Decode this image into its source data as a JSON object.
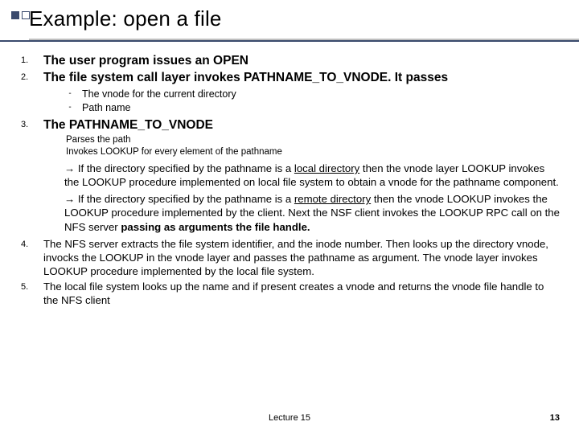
{
  "title": "Example: open a file",
  "items": {
    "n1": "1.",
    "t1": "The user program issues an OPEN",
    "n2": "2.",
    "t2": "The file system call layer invokes PATHNAME_TO_VNODE. It passes",
    "s2a": "The vnode for the current directory",
    "s2b": "Path name",
    "n3": "3.",
    "t3": "The PATHNAME_TO_VNODE",
    "s3a": "Parses the path",
    "s3b": "Invokes LOOKUP for every element of the pathname",
    "p3a_pre": "→ If the directory specified by the pathname is a ",
    "p3a_u": "local directory",
    "p3a_post": " then the vnode layer LOOKUP invokes the LOOKUP procedure implemented on  local file  system to obtain a vnode for the pathname component.",
    "p3b_pre": "→ If the directory specified by the pathname is a ",
    "p3b_u": "remote directory",
    "p3b_mid": " then the vnode LOOKUP  invokes the LOOKUP procedure implemented by  the client. Next the NSF client invokes the LOOKUP RPC call on the NFS server ",
    "p3b_bold": "passing as arguments the file handle.",
    "n4": "4.",
    "t4": "The NFS server extracts the file system identifier, and the inode number. Then looks up the directory vnode, invocks the LOOKUP in the vnode layer  and passes the pathname as argument.  The vnode layer invokes LOOKUP procedure implemented by the local file system.",
    "n5": "5.",
    "t5": "The local file system looks up the name and if present creates a vnode and returns the vnode file handle to the NFS client"
  },
  "footer": {
    "center": "Lecture 15",
    "page": "13"
  }
}
